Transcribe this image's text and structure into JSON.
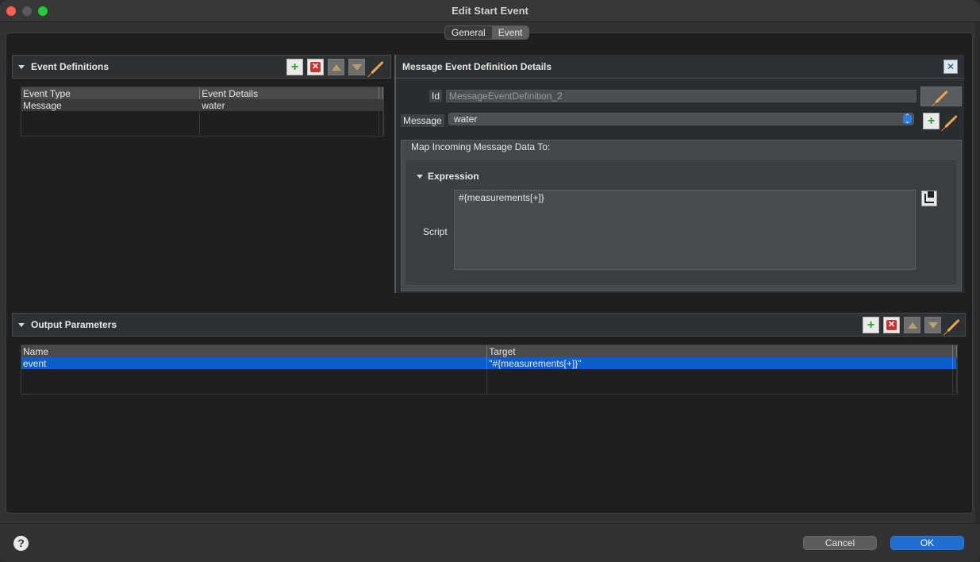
{
  "window": {
    "title": "Edit Start Event"
  },
  "tabs": [
    {
      "label": "General",
      "active": false
    },
    {
      "label": "Event",
      "active": true
    }
  ],
  "event_definitions": {
    "title": "Event Definitions",
    "columns": [
      "Event Type",
      "Event Details"
    ],
    "rows": [
      {
        "type": "Message",
        "details": "water"
      }
    ]
  },
  "details": {
    "title": "Message Event Definition Details",
    "id_label": "Id",
    "id_value": "MessageEventDefinition_2",
    "message_label": "Message",
    "message_value": "water",
    "group_label": "Map Incoming Message Data To:",
    "expression_label": "Expression",
    "script_label": "Script",
    "script_value": "#{measurements[+]}"
  },
  "output_parameters": {
    "title": "Output Parameters",
    "columns": [
      "Name",
      "Target"
    ],
    "rows": [
      {
        "name": "event",
        "target": "\"#{measurements[+]}\"",
        "selected": true
      }
    ]
  },
  "footer": {
    "help": "?",
    "cancel": "Cancel",
    "ok": "OK"
  },
  "colors": {
    "accent": "#1f6fd1",
    "selection": "#0a5fd0",
    "add": "#29a329",
    "remove": "#d32f2f"
  }
}
